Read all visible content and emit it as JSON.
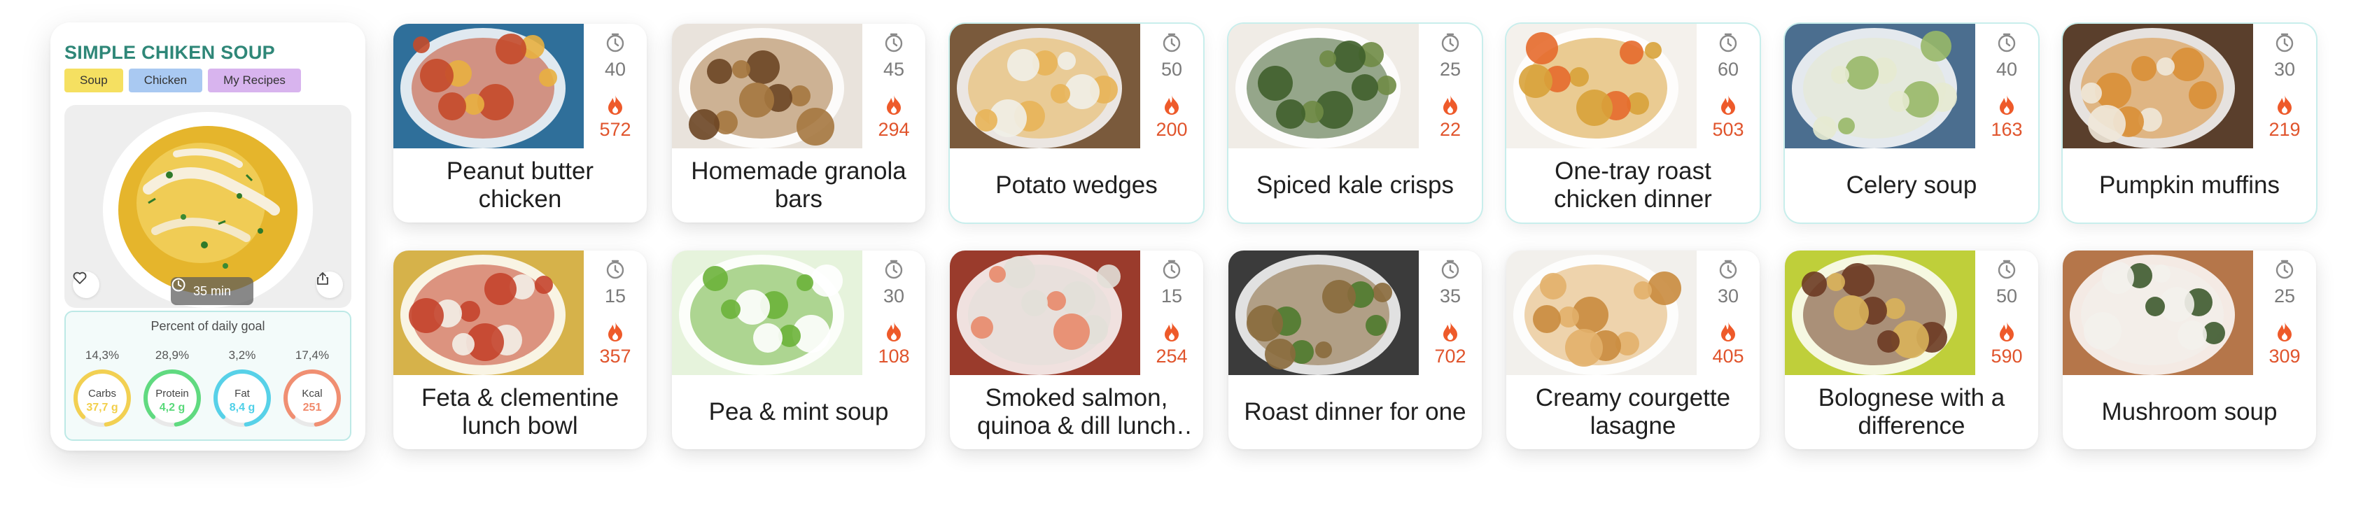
{
  "detail": {
    "title": "SIMPLE CHIKEN SOUP",
    "tags": [
      {
        "label": "Soup",
        "color": "#f5e061"
      },
      {
        "label": "Chicken",
        "color": "#a9c9f2"
      },
      {
        "label": "My Recipes",
        "color": "#d8b4ee"
      }
    ],
    "time": "35 min",
    "icons": {
      "like": "heart-icon",
      "share": "share-icon",
      "time": "clock-icon"
    },
    "goal": {
      "title": "Percent of daily goal",
      "items": [
        {
          "pct_label": "14,3%",
          "pct": 0.143,
          "name": "Carbs",
          "value": "37,7 g",
          "color": "#f2cf4a"
        },
        {
          "pct_label": "28,9%",
          "pct": 0.289,
          "name": "Protein",
          "value": "4,2 g",
          "color": "#59d97a"
        },
        {
          "pct_label": "3,2%",
          "pct": 0.032,
          "name": "Fat",
          "value": "8,4 g",
          "color": "#4fd0e8"
        },
        {
          "pct_label": "17,4%",
          "pct": 0.174,
          "name": "Kcal",
          "value": "251",
          "color": "#f08a6c"
        }
      ]
    }
  },
  "recipes": [
    {
      "name": "Peanut butter chicken",
      "minutes": "40",
      "kcal": "572",
      "palette": [
        "#2f6f9a",
        "#c44a2a",
        "#e8b040"
      ]
    },
    {
      "name": "Homemade granola bars",
      "minutes": "45",
      "kcal": "294",
      "palette": [
        "#e9e3dc",
        "#a5773f",
        "#6b4523"
      ]
    },
    {
      "name": "Potato wedges",
      "minutes": "50",
      "kcal": "200",
      "palette": [
        "#7a5a3c",
        "#e8b458",
        "#f1efe8"
      ]
    },
    {
      "name": "Spiced kale crisps",
      "minutes": "25",
      "kcal": "22",
      "palette": [
        "#f0ece6",
        "#3f5f2b",
        "#6f8b45"
      ]
    },
    {
      "name": "One-tray roast chicken dinner",
      "minutes": "60",
      "kcal": "503",
      "palette": [
        "#f4f1ec",
        "#d8a23a",
        "#e56a2c"
      ]
    },
    {
      "name": "Celery soup",
      "minutes": "40",
      "kcal": "163",
      "palette": [
        "#4b6e8f",
        "#e6ead0",
        "#98b868"
      ]
    },
    {
      "name": "Pumpkin muffins",
      "minutes": "30",
      "kcal": "219",
      "palette": [
        "#5a3f2c",
        "#d98f36",
        "#efe8d9"
      ]
    },
    {
      "name": "Feta & clementine lunch bowl",
      "minutes": "15",
      "kcal": "357",
      "palette": [
        "#d6b24a",
        "#c4442c",
        "#f3f0e8"
      ]
    },
    {
      "name": "Pea & mint soup",
      "minutes": "30",
      "kcal": "108",
      "palette": [
        "#e6f3dc",
        "#6bb33a",
        "#ffffff"
      ]
    },
    {
      "name": "Smoked salmon, quinoa & dill lunch bowl",
      "minutes": "15",
      "kcal": "254",
      "palette": [
        "#9a3b2c",
        "#e2e0d8",
        "#e88a6a"
      ]
    },
    {
      "name": "Roast dinner for one",
      "minutes": "35",
      "kcal": "702",
      "palette": [
        "#3b3b3b",
        "#8a6a3c",
        "#4f7a2e"
      ]
    },
    {
      "name": "Creamy courgette lasagne",
      "minutes": "30",
      "kcal": "405",
      "palette": [
        "#f2f0ec",
        "#e2b06a",
        "#c98b3e"
      ]
    },
    {
      "name": "Bolognese with a difference",
      "minutes": "50",
      "kcal": "590",
      "palette": [
        "#bfcf3a",
        "#6b3a22",
        "#d9b25a"
      ]
    },
    {
      "name": "Mushroom soup",
      "minutes": "25",
      "kcal": "309",
      "palette": [
        "#b5764a",
        "#f3f1ec",
        "#3e5a2f"
      ]
    }
  ],
  "colors": {
    "minutes": "#7a7a7a",
    "kcal": "#e0542c",
    "flame": "#ee5a2a",
    "title": "#2f8778"
  }
}
